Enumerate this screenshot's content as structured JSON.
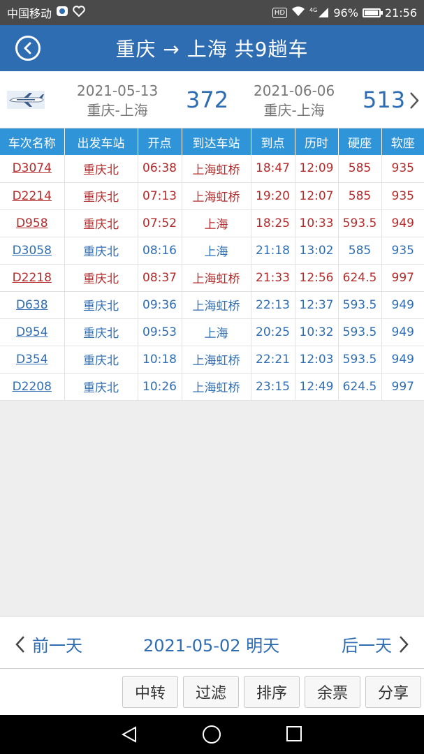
{
  "status_bar": {
    "carrier": "中国移动",
    "hd_label": "HD",
    "network_label": "4G",
    "battery_percent": 96,
    "battery_text": "96%",
    "time": "21:56",
    "icons": [
      "app-notification-icon",
      "heart-icon",
      "wifi-icon",
      "signal-icon",
      "battery-icon"
    ]
  },
  "header": {
    "title": "重庆 → 上海 共9趟车",
    "back_icon": "back-icon",
    "color": "#2f6db3"
  },
  "flight_offers": [
    {
      "date": "2021-05-13",
      "route": "重庆-上海",
      "price": "372"
    },
    {
      "date": "2021-06-06",
      "route": "重庆-上海",
      "price": "513"
    }
  ],
  "table": {
    "columns": [
      "车次名称",
      "出发车站",
      "开点",
      "到达车站",
      "到点",
      "历时",
      "硬座",
      "软座"
    ],
    "rows": [
      {
        "code": "D3074",
        "from": "重庆北",
        "depart": "06:38",
        "to": "上海虹桥",
        "arrive": "18:47",
        "duration": "12:09",
        "hard_seat": "585",
        "soft_seat": "935",
        "style": "red"
      },
      {
        "code": "D2214",
        "from": "重庆北",
        "depart": "07:13",
        "to": "上海虹桥",
        "arrive": "19:20",
        "duration": "12:07",
        "hard_seat": "585",
        "soft_seat": "935",
        "style": "red"
      },
      {
        "code": "D958",
        "from": "重庆北",
        "depart": "07:52",
        "to": "上海",
        "arrive": "18:25",
        "duration": "10:33",
        "hard_seat": "593.5",
        "soft_seat": "949",
        "style": "red"
      },
      {
        "code": "D3058",
        "from": "重庆北",
        "depart": "08:16",
        "to": "上海",
        "arrive": "21:18",
        "duration": "13:02",
        "hard_seat": "585",
        "soft_seat": "935",
        "style": "blue"
      },
      {
        "code": "D2218",
        "from": "重庆北",
        "depart": "08:37",
        "to": "上海虹桥",
        "arrive": "21:33",
        "duration": "12:56",
        "hard_seat": "624.5",
        "soft_seat": "997",
        "style": "red"
      },
      {
        "code": "D638",
        "from": "重庆北",
        "depart": "09:36",
        "to": "上海虹桥",
        "arrive": "22:13",
        "duration": "12:37",
        "hard_seat": "593.5",
        "soft_seat": "949",
        "style": "blue"
      },
      {
        "code": "D954",
        "from": "重庆北",
        "depart": "09:53",
        "to": "上海",
        "arrive": "20:25",
        "duration": "10:32",
        "hard_seat": "593.5",
        "soft_seat": "949",
        "style": "blue"
      },
      {
        "code": "D354",
        "from": "重庆北",
        "depart": "10:18",
        "to": "上海虹桥",
        "arrive": "22:21",
        "duration": "12:03",
        "hard_seat": "593.5",
        "soft_seat": "949",
        "style": "blue"
      },
      {
        "code": "D2208",
        "from": "重庆北",
        "depart": "10:26",
        "to": "上海虹桥",
        "arrive": "23:15",
        "duration": "12:49",
        "hard_seat": "624.5",
        "soft_seat": "997",
        "style": "blue"
      }
    ],
    "colors": {
      "header_bg": "#2f95d8",
      "red_text": "#b32b2b",
      "blue_text": "#2f6db3"
    }
  },
  "day_nav": {
    "prev_label": "前一天",
    "current": "2021-05-02 明天",
    "next_label": "后一天"
  },
  "toolbar": {
    "buttons": [
      "中转",
      "过滤",
      "排序",
      "余票",
      "分享"
    ]
  },
  "nav_bar": {
    "icons": [
      "nav-back-icon",
      "nav-home-icon",
      "nav-recent-icon"
    ]
  }
}
